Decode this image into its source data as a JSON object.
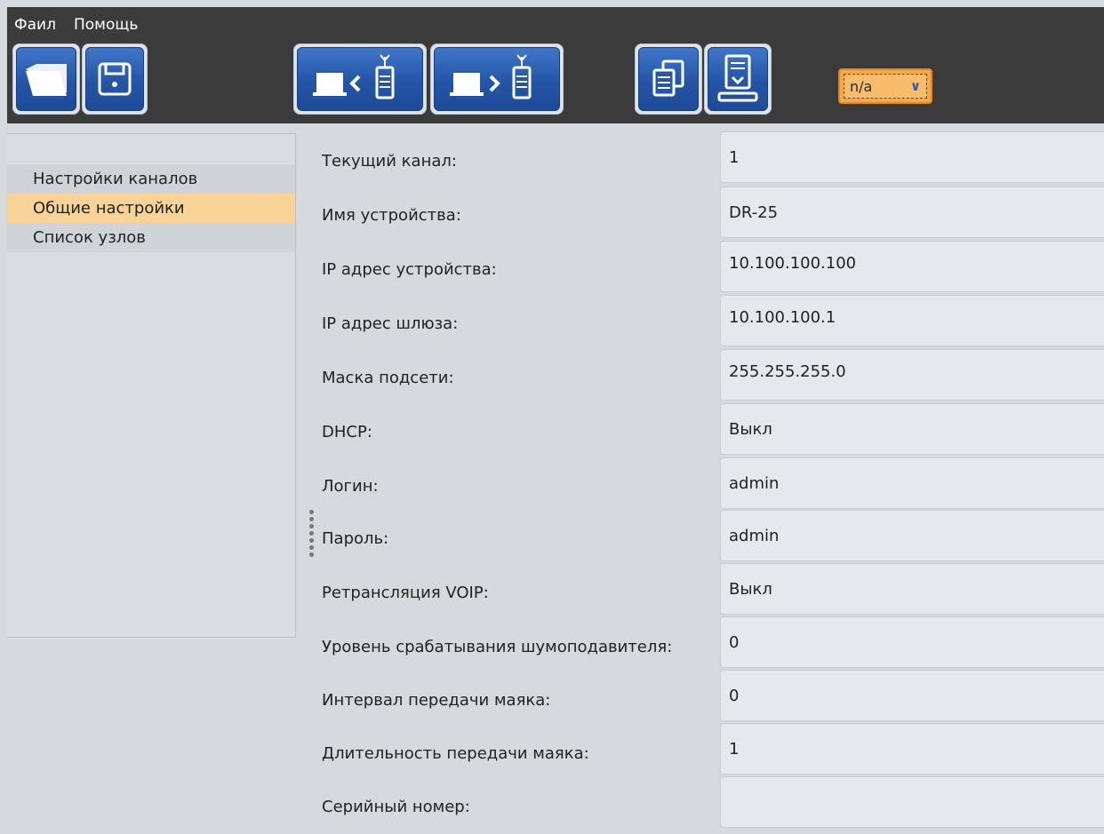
{
  "menu": {
    "file": "Фаил",
    "help": "Помощь"
  },
  "toolbar": {
    "buttons": [
      {
        "name": "open-file",
        "icon": "folder-icon"
      },
      {
        "name": "save-file",
        "icon": "floppy-disk-icon"
      },
      {
        "name": "read-from-device",
        "icon": "computer-from-radio-icon"
      },
      {
        "name": "write-to-device",
        "icon": "computer-to-radio-icon"
      },
      {
        "name": "copy",
        "icon": "copy-documents-icon"
      },
      {
        "name": "firmware-upload",
        "icon": "download-document-icon"
      }
    ],
    "combo_value": "n/a",
    "accent_color": "#2455a6",
    "combo_color": "#f5a847"
  },
  "sidebar": {
    "items": [
      {
        "label": "Настройки каналов"
      },
      {
        "label": "Общие настройки",
        "selected": true
      },
      {
        "label": "Список узлов"
      }
    ]
  },
  "settings": {
    "fields": [
      {
        "label": "Текущий канал:",
        "value": "1"
      },
      {
        "label": "Имя устройства:",
        "value": "DR-25"
      },
      {
        "label": "IP адрес устройства:",
        "value": "10.100.100.100"
      },
      {
        "label": "IP адрес шлюза:",
        "value": "10.100.100.1"
      },
      {
        "label": "Маска подсети:",
        "value": "255.255.255.0"
      },
      {
        "label": "DHCP:",
        "value": "Выкл"
      },
      {
        "label": "Логин:",
        "value": "admin"
      },
      {
        "label": "Пароль:",
        "value": "admin"
      },
      {
        "label": "Ретрансляция VOIP:",
        "value": "Выкл"
      },
      {
        "label": "Уровень срабатывания шумоподавителя:",
        "value": "0"
      },
      {
        "label": "Интервал передачи маяка:",
        "value": "0"
      },
      {
        "label": "Длительность передачи маяка:",
        "value": "1"
      },
      {
        "label": "Серийный номер:",
        "value": ""
      }
    ]
  }
}
